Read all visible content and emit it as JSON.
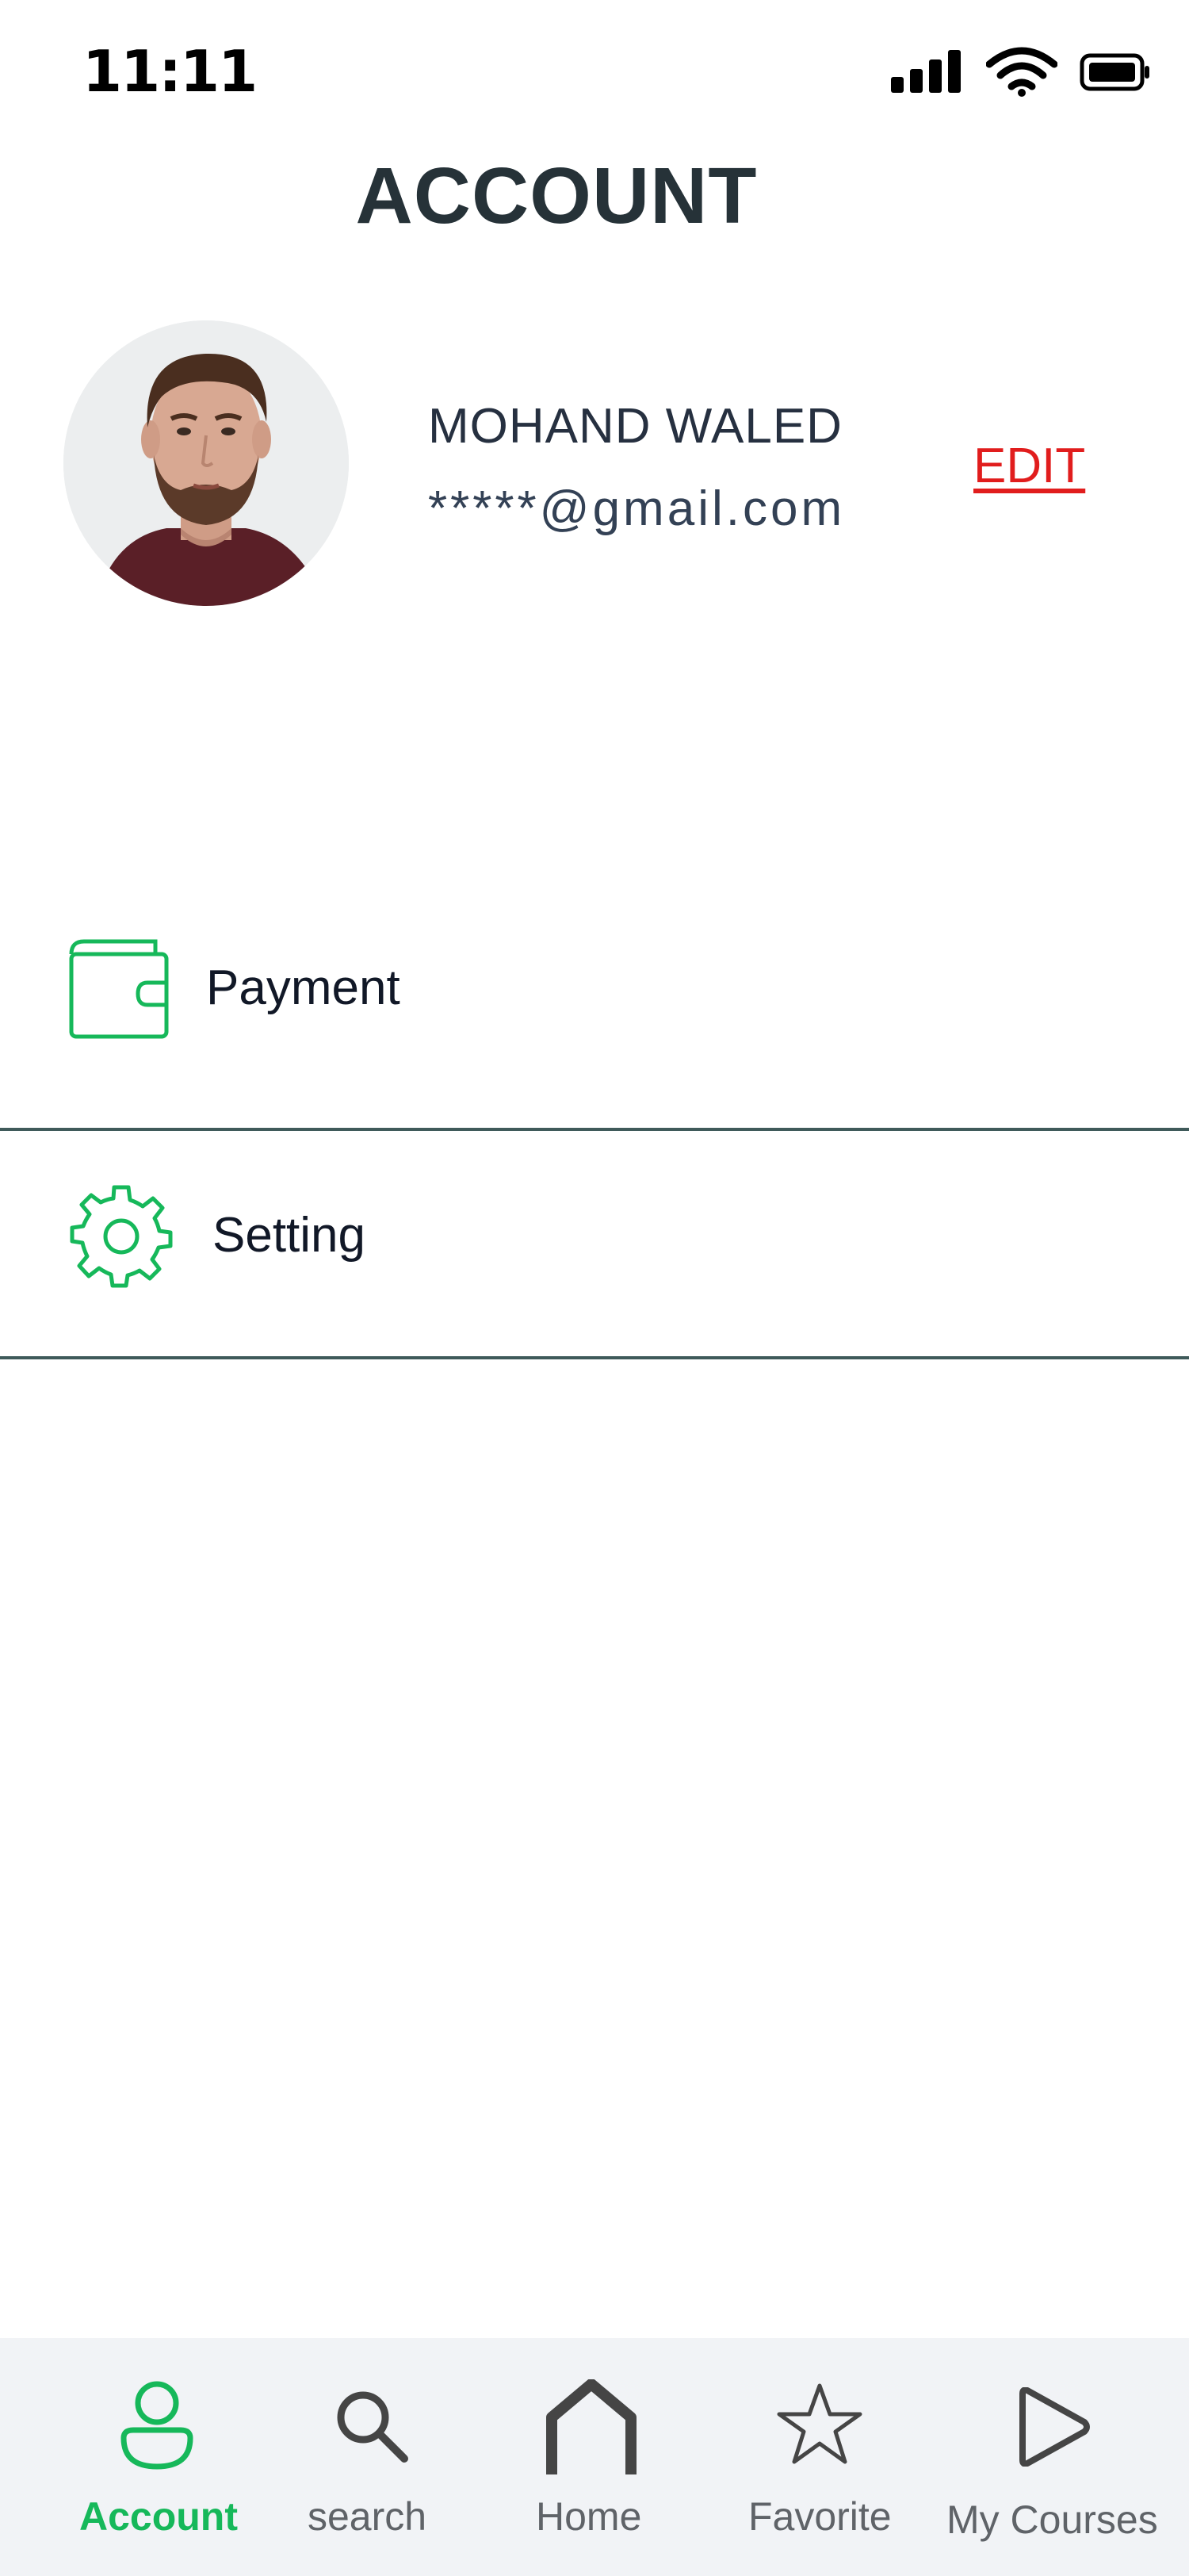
{
  "status_bar": {
    "time": "11:11",
    "icons": [
      "signal-icon",
      "wifi-icon",
      "battery-icon"
    ]
  },
  "header": {
    "title": "ACCOUNT"
  },
  "profile": {
    "name": "MOHAND WALED",
    "email": "*****@gmail.com",
    "edit_label": "EDIT"
  },
  "menu": {
    "items": [
      {
        "label": "Payment",
        "icon": "wallet-icon"
      },
      {
        "label": "Setting",
        "icon": "gear-icon"
      }
    ]
  },
  "bottom_nav": {
    "items": [
      {
        "label": "Account",
        "icon": "person-icon",
        "active": true
      },
      {
        "label": "search",
        "icon": "search-icon",
        "active": false
      },
      {
        "label": "Home",
        "icon": "home-icon",
        "active": false
      },
      {
        "label": "Favorite",
        "icon": "star-icon",
        "active": false
      },
      {
        "label": "My Courses",
        "icon": "play-icon",
        "active": false
      }
    ]
  },
  "colors": {
    "accent": "#16b85a",
    "edit": "#e11d1d",
    "title": "#263238",
    "divider": "#3f5a5a",
    "nav_background": "#f1f3f6"
  }
}
